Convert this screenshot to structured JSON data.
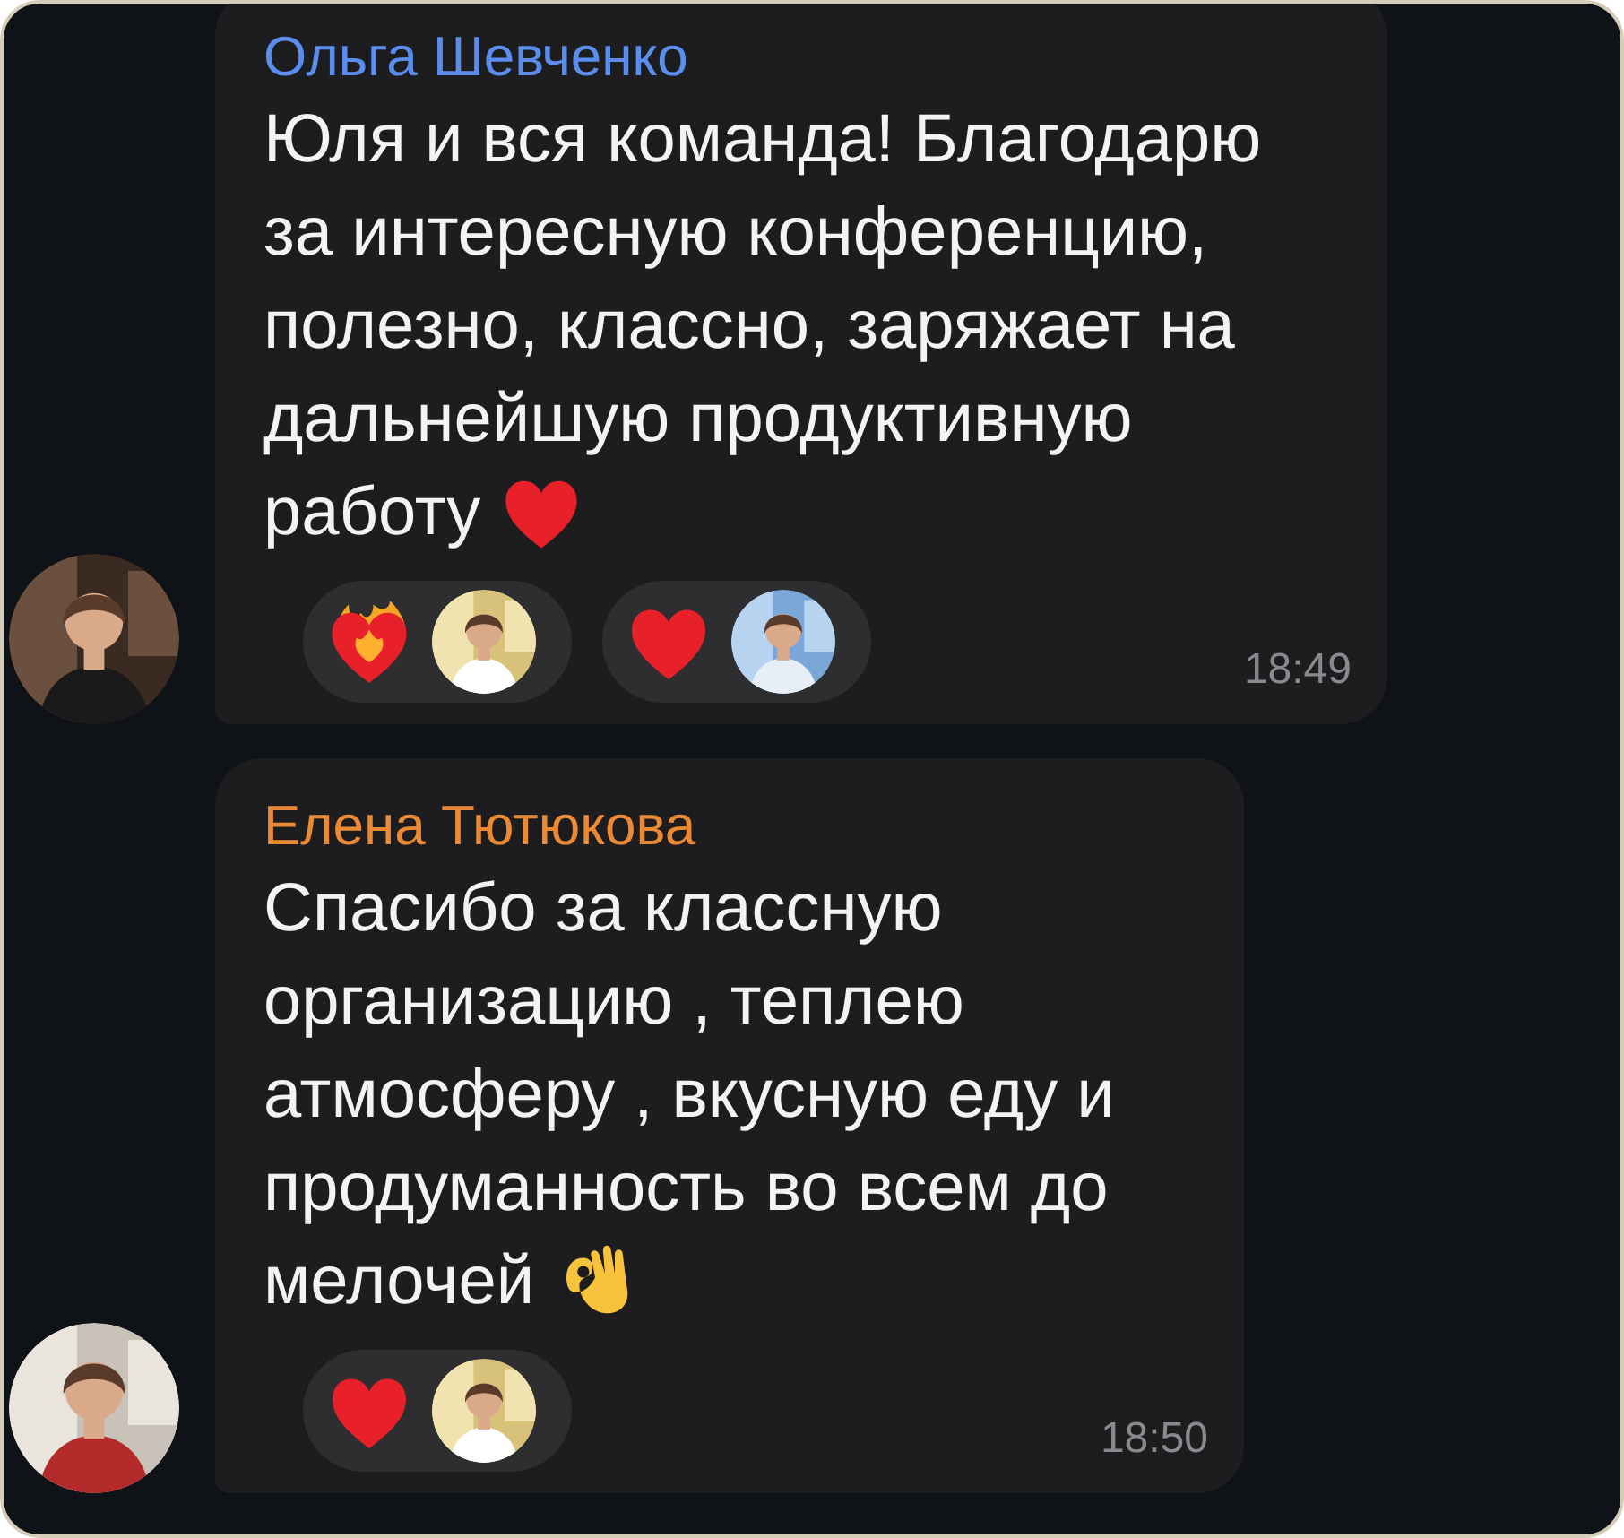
{
  "messages": [
    {
      "sender": "Ольга Шевченко",
      "color": "#5b8def",
      "lines": [
        "Юля и вся команда! Благодарю",
        "за интересную конференцию,",
        "полезно, классно, заряжает на",
        "дальнейшую продуктивную",
        "работу"
      ],
      "emoji": {
        "kind": "heart"
      },
      "reactions": [
        {
          "kind": "fire-heart"
        },
        {
          "kind": "heart"
        }
      ],
      "time": "18:49"
    },
    {
      "sender": "Елена Тютюкова",
      "color": "#ec8a33",
      "lines": [
        "Спасибо за классную",
        "организацию , теплею",
        "атмосферу , вкусную еду и",
        "продуманность во всем до",
        "мелочей"
      ],
      "emoji": {
        "kind": "ok-hand"
      },
      "reactions": [
        {
          "kind": "heart"
        }
      ],
      "time": "18:50"
    }
  ]
}
